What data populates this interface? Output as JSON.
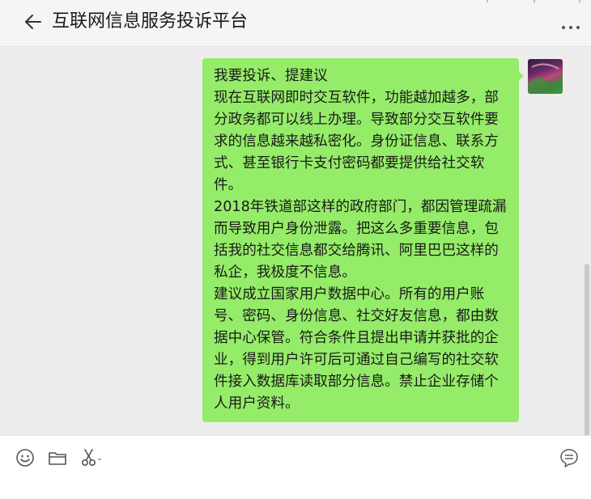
{
  "header": {
    "title": "互联网信息服务投诉平台"
  },
  "message": {
    "text": "我要投诉、提建议\n现在互联网即时交互软件，功能越加越多，部分政务都可以线上办理。导致部分交互软件要求的信息越来越私密化。身份证信息、联系方式、甚至银行卡支付密码都要提供给社交软件。\n2018年铁道部这样的政府部门，都因管理疏漏而导致用户身份泄露。把这么多重要信息，包括我的社交信息都交给腾讯、阿里巴巴这样的私企，我极度不信息。\n建议成立国家用户数据中心。所有的用户账号、密码、身份信息、社交好友信息，都由数据中心保管。符合条件且提出申请并获批的企业，得到用户许可后可通过自己编写的社交软件接入数据库读取部分信息。禁止企业存储个人用户资料。"
  },
  "colors": {
    "bubble": "#95ec69",
    "chat_background": "#ededed",
    "header_background": "#f5f5f5"
  },
  "icons": {
    "back": "arrow-left-icon",
    "more": "more-dots-icon",
    "emoji": "emoji-icon",
    "folder": "folder-icon",
    "scissors": "scissors-icon",
    "history": "chat-history-icon"
  }
}
